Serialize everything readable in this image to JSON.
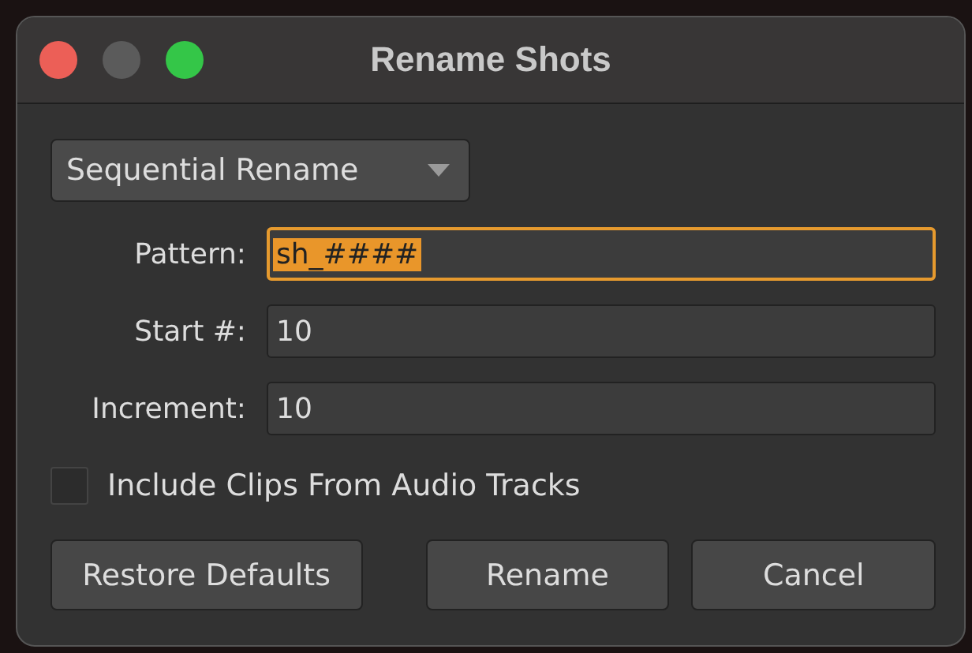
{
  "window": {
    "title": "Rename Shots"
  },
  "mode_dropdown": {
    "value": "Sequential Rename"
  },
  "fields": [
    {
      "label": "Pattern:",
      "value": "sh_####",
      "focused": true
    },
    {
      "label": "Start #:",
      "value": "10",
      "focused": false
    },
    {
      "label": "Increment:",
      "value": "10",
      "focused": false
    }
  ],
  "include_audio": {
    "label": "Include Clips From Audio Tracks",
    "checked": false
  },
  "buttons": [
    "Restore Defaults",
    "Rename",
    "Cancel"
  ]
}
